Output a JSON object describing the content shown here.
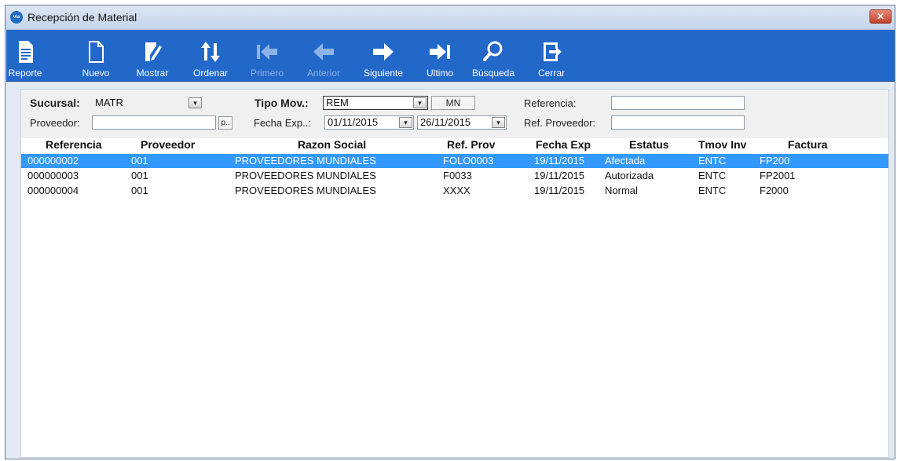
{
  "window": {
    "title": "Recepción de Material",
    "app_icon_text": "via",
    "close_symbol": "✕"
  },
  "toolbar": [
    {
      "label": "Reporte",
      "icon": "report-icon",
      "enabled": true
    },
    {
      "label": "Nuevo",
      "icon": "new-document-icon",
      "enabled": true
    },
    {
      "label": "Mostrar",
      "icon": "edit-icon",
      "enabled": true
    },
    {
      "label": "Ordenar",
      "icon": "sort-icon",
      "enabled": true
    },
    {
      "label": "Primero",
      "icon": "first-arrow-icon",
      "enabled": false
    },
    {
      "label": "Anterior",
      "icon": "previous-arrow-icon",
      "enabled": false
    },
    {
      "label": "Siguiente",
      "icon": "next-arrow-icon",
      "enabled": true
    },
    {
      "label": "Ultimo",
      "icon": "last-arrow-icon",
      "enabled": true
    },
    {
      "label": "Búsqueda",
      "icon": "search-icon",
      "enabled": true
    },
    {
      "label": "Cerrar",
      "icon": "exit-icon",
      "enabled": true
    }
  ],
  "filters": {
    "sucursal_label": "Sucursal:",
    "sucursal_value": "MATR",
    "tipo_mov_label": "Tipo Mov.:",
    "tipo_mov_value": "REM",
    "currency_value": "MN",
    "referencia_label": "Referencia:",
    "referencia_value": "",
    "proveedor_label": "Proveedor:",
    "proveedor_value": "",
    "proveedor_btn": "p..",
    "fecha_exp_label": "Fecha Exp..:",
    "fecha_from": "01/11/2015",
    "fecha_to": "26/11/2015",
    "ref_proveedor_label": "Ref. Proveedor:",
    "ref_proveedor_value": "",
    "dropdown_glyph": "▾"
  },
  "table": {
    "columns": [
      "Referencia",
      "Proveedor",
      "Razon Social",
      "Ref. Prov",
      "Fecha Exp",
      "Estatus",
      "Tmov Inv",
      "Factura"
    ],
    "rows": [
      [
        "000000002",
        "001",
        "PROVEEDORES MUNDIALES",
        "FOLO0003",
        "19/11/2015",
        "Afectada",
        "ENTC",
        "FP200"
      ],
      [
        "000000003",
        "001",
        "PROVEEDORES MUNDIALES",
        "F0033",
        "19/11/2015",
        "Autorizada",
        "ENTC",
        "FP2001"
      ],
      [
        "000000004",
        "001",
        "PROVEEDORES MUNDIALES",
        "XXXX",
        "19/11/2015",
        "Normal",
        "ENTC",
        "F2000"
      ]
    ],
    "selected_row": 0
  },
  "colors": {
    "toolbar": "#2268c9",
    "selection": "#3399ff",
    "window_bg": "#e3eaf3"
  }
}
